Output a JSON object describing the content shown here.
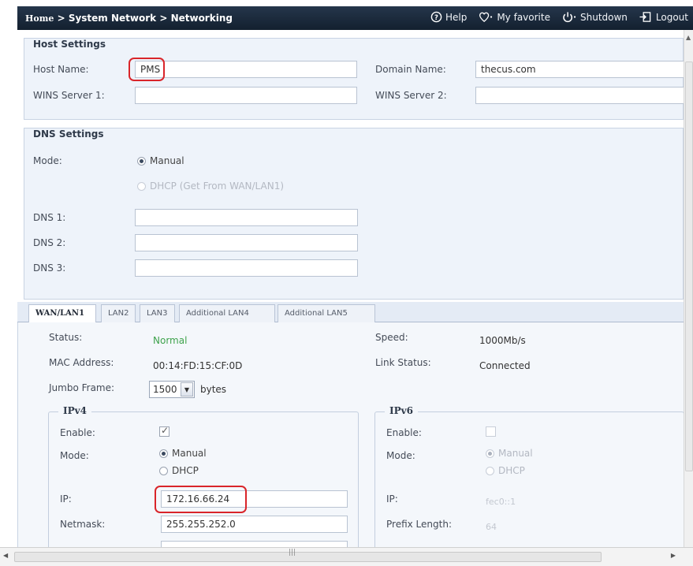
{
  "header": {
    "breadcrumb_home": "Home",
    "breadcrumb_sep1": ">",
    "breadcrumb_section": "System Network",
    "breadcrumb_sep2": ">",
    "breadcrumb_page": "Networking",
    "help_label": "Help",
    "favorite_label": "My favorite",
    "shutdown_label": "Shutdown",
    "logout_label": "Logout"
  },
  "host_settings": {
    "legend": "Host Settings",
    "host_name_label": "Host Name:",
    "host_name_value": "PMS",
    "domain_name_label": "Domain Name:",
    "domain_name_value": "thecus.com",
    "wins1_label": "WINS Server 1:",
    "wins1_value": "",
    "wins2_label": "WINS Server 2:",
    "wins2_value": ""
  },
  "dns_settings": {
    "legend": "DNS Settings",
    "mode_label": "Mode:",
    "mode_options": [
      "Manual",
      "DHCP (Get From WAN/LAN1)"
    ],
    "mode_selected": "Manual",
    "dns1_label": "DNS 1:",
    "dns2_label": "DNS 2:",
    "dns3_label": "DNS 3:",
    "dns1_value": "",
    "dns2_value": "",
    "dns3_value": ""
  },
  "tabs": [
    {
      "label": "WAN/LAN1",
      "active": true
    },
    {
      "label": "LAN2",
      "active": false
    },
    {
      "label": "LAN3",
      "active": false
    },
    {
      "label": "Additional LAN4",
      "active": false
    },
    {
      "label": "Additional LAN5",
      "active": false
    }
  ],
  "wan": {
    "status_label": "Status:",
    "status_value": "Normal",
    "mac_label": "MAC Address:",
    "mac_value": "00:14:FD:15:CF:0D",
    "jumbo_label": "Jumbo Frame:",
    "jumbo_value": "1500",
    "jumbo_unit": "bytes",
    "speed_label": "Speed:",
    "speed_value": "1000Mb/s",
    "link_label": "Link Status:",
    "link_value": "Connected",
    "ipv4": {
      "legend": "IPv4",
      "enable_label": "Enable:",
      "enabled": true,
      "mode_label": "Mode:",
      "mode_options": [
        "Manual",
        "DHCP"
      ],
      "mode_selected": "Manual",
      "ip_label": "IP:",
      "ip_value": "172.16.66.24",
      "netmask_label": "Netmask:",
      "netmask_value": "255.255.252.0"
    },
    "ipv6": {
      "legend": "IPv6",
      "enable_label": "Enable:",
      "enabled": false,
      "mode_label": "Mode:",
      "mode_options": [
        "Manual",
        "DHCP"
      ],
      "mode_selected": "Manual",
      "ip_label": "IP:",
      "ip_value": "fec0::1",
      "prefix_label": "Prefix Length:",
      "prefix_value": "64"
    }
  },
  "colors": {
    "header_bg": "#1a2a3c",
    "panel_bg": "#eef3fa",
    "highlight": "#d9252a",
    "status_ok": "#3fa34d"
  },
  "icons": {
    "help": "help-icon",
    "favorite": "heart-icon",
    "shutdown": "power-icon",
    "logout": "logout-icon"
  }
}
